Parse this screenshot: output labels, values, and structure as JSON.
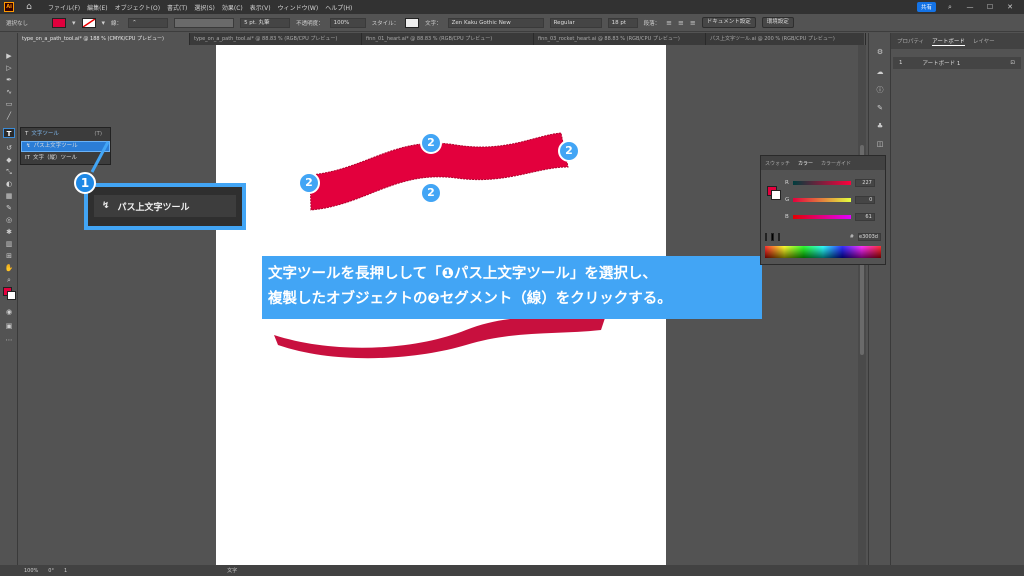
{
  "app": {
    "logo": "Ai",
    "menus": [
      "ファイル(F)",
      "編集(E)",
      "オブジェクト(O)",
      "書式(T)",
      "選択(S)",
      "効果(C)",
      "表示(V)",
      "ウィンドウ(W)",
      "ヘルプ(H)"
    ],
    "share_label": "共有"
  },
  "controlbar": {
    "selection_label": "選択なし",
    "stroke_label": "線：",
    "brush_value": "5 pt. 丸筆",
    "opacity_label": "不透明度：",
    "opacity_value": "100%",
    "style_label": "スタイル：",
    "text_label": "文字：",
    "font_name": "Zen Kaku Gothic New",
    "font_style": "Regular",
    "font_size": "18 pt",
    "paragraph_label": "段落：",
    "doc_setup_button": "ドキュメント設定",
    "prefs_button": "環境設定",
    "fill_color": "#e0003d"
  },
  "tabs": [
    "type_on_a_path_tool.ai* @ 188 % (CMYK/CPU プレビュー)",
    "type_on_a_path_tool.ai* @ 88.83 % (RGB/CPU プレビュー)",
    "finn_01_heart.ai* @ 88.83 % (RGB/CPU プレビュー)",
    "finn_03_rocket_heart.ai @ 88.83 % (RGB/CPU プレビュー)",
    "パス上文字ツール.ai @ 200 % (RGB/CPU プレビュー)"
  ],
  "flyout": {
    "items": [
      {
        "label": "文字ツール",
        "shortcut": "(T)"
      },
      {
        "label": "パス上文字ツール",
        "shortcut": ""
      },
      {
        "label": "文字（縦）ツール",
        "shortcut": ""
      }
    ]
  },
  "callout": {
    "number": "1",
    "label": "パス上文字ツール"
  },
  "markers": [
    "2",
    "2",
    "2",
    "2"
  ],
  "instruction": {
    "line1": "文字ツールを長押しして「❶パス上文字ツール」を選択し、",
    "line2": "複製したオブジェクトの❷セグメント（線）をクリックする。"
  },
  "right_panel": {
    "tabs": [
      "プロパティ",
      "アートボード",
      "レイヤー"
    ],
    "artboard_index": "1",
    "artboard_name": "アートボード 1"
  },
  "color_panel": {
    "tabs": [
      "スウォッチ",
      "カラー",
      "カラーガイド"
    ],
    "r_label": "R",
    "g_label": "G",
    "b_label": "B",
    "r_value": "227",
    "g_value": "0",
    "b_value": "61",
    "hex_value": "e3003d",
    "current_color": "#e3003d"
  },
  "status": {
    "zoom": "100%",
    "angle": "0°",
    "page": "1",
    "tool": "文字"
  }
}
